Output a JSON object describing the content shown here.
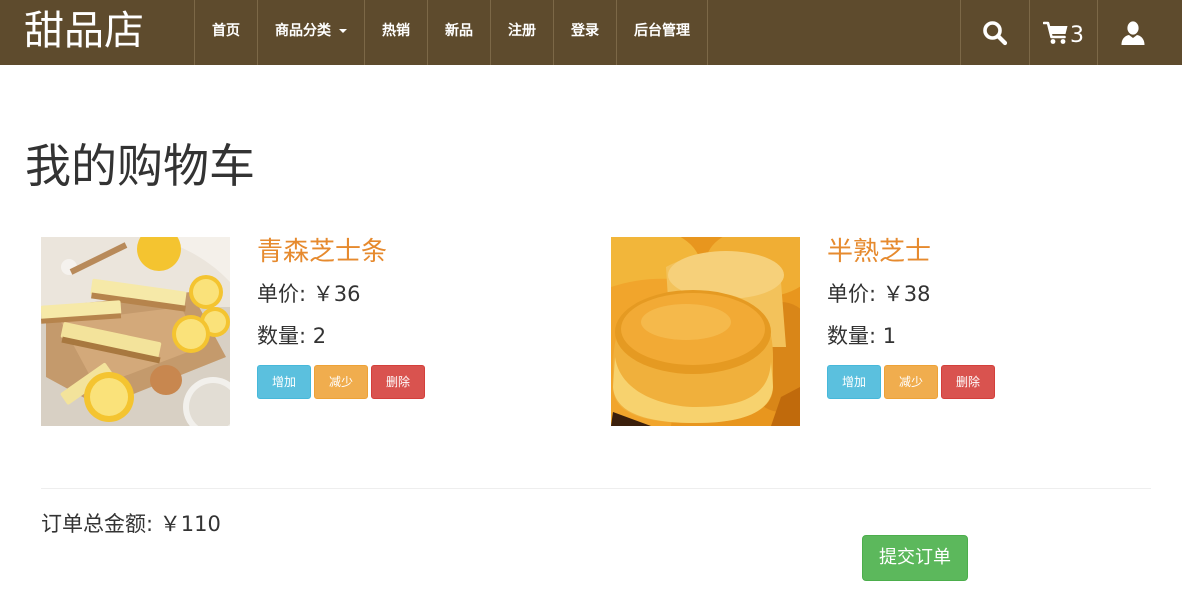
{
  "brand": "甜品店",
  "nav": {
    "home": "首页",
    "categories": "商品分类",
    "hot": "热销",
    "new": "新品",
    "register": "注册",
    "login": "登录",
    "admin": "后台管理"
  },
  "icons": {
    "search": "search-icon",
    "cart": "cart-icon",
    "user": "user-icon"
  },
  "cart_count": "3",
  "page_title": "我的购物车",
  "items": [
    {
      "name": "青森芝士条",
      "price": "单价: ￥36",
      "quantity": "数量: 2",
      "buttons": {
        "increase": "增加",
        "decrease": "减少",
        "delete": "删除"
      }
    },
    {
      "name": "半熟芝士",
      "price": "单价: ￥38",
      "quantity": "数量: 1",
      "buttons": {
        "increase": "增加",
        "decrease": "减少",
        "delete": "删除"
      }
    }
  ],
  "order_total": "订单总金额: ￥110",
  "submit_label": "提交订单",
  "colors": {
    "navbar": "#5e4b2d",
    "item_name": "#e68a2e",
    "info_button": "#5bc0de",
    "warning_button": "#f0ad4e",
    "danger_button": "#d9534f",
    "success_button": "#5cb85c"
  }
}
